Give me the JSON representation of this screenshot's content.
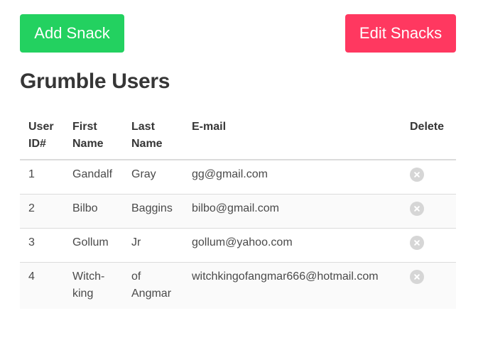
{
  "toolbar": {
    "add_label": "Add Snack",
    "edit_label": "Edit Snacks"
  },
  "colors": {
    "add_button": "#23d160",
    "edit_button": "#ff3860",
    "delete_icon": "#d6d6d6"
  },
  "page": {
    "title": "Grumble Users"
  },
  "table": {
    "headers": {
      "id_line1": "User",
      "id_line2": "ID#",
      "first_line1": "First",
      "first_line2": "Name",
      "last_line1": "Last",
      "last_line2": "Name",
      "email": "E-mail",
      "delete": "Delete"
    },
    "rows": [
      {
        "id": "1",
        "first": "Gandalf",
        "last": "Gray",
        "email": "gg@gmail.com",
        "delete_icon": "close-circle-icon"
      },
      {
        "id": "2",
        "first": "Bilbo",
        "last": "Baggins",
        "email": "bilbo@gmail.com",
        "delete_icon": "close-circle-icon"
      },
      {
        "id": "3",
        "first": "Gollum",
        "last": "Jr",
        "email": "gollum@yahoo.com",
        "delete_icon": "close-circle-icon"
      },
      {
        "id": "4",
        "first": "Witch-king",
        "last": "of Angmar",
        "email": "witchkingofangmar666@hotmail.com",
        "delete_icon": "close-circle-icon"
      }
    ]
  }
}
